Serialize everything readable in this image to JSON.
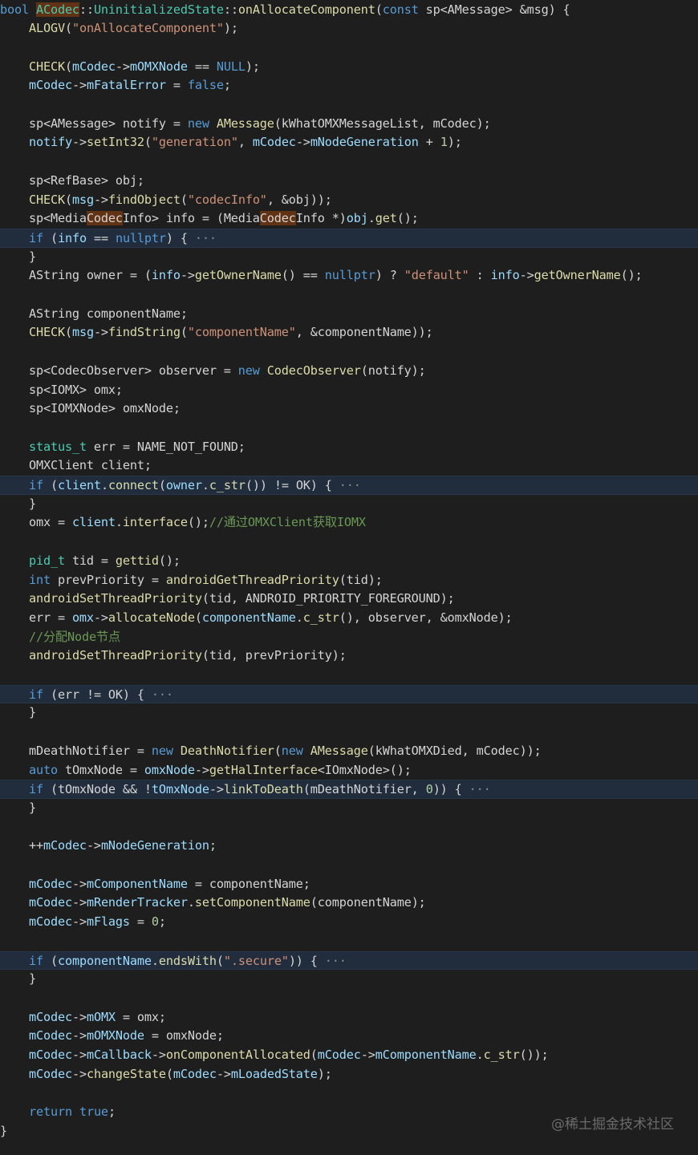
{
  "watermark": "@稀土掘金技术社区",
  "colors": {
    "background": "#1e1e1e",
    "fold_line_background": "#212c3c",
    "match_highlight": "#613214"
  },
  "code_lines": [
    [
      [
        "kw",
        "bool "
      ],
      [
        "hl",
        "ACodec"
      ],
      [
        "text",
        "::"
      ],
      [
        "type",
        "UninitializedState"
      ],
      [
        "text",
        "::"
      ],
      [
        "fn",
        "onAllocateComponent"
      ],
      [
        "text",
        "("
      ],
      [
        "kw",
        "const"
      ],
      [
        "text",
        " sp<AMessage> &msg) {"
      ]
    ],
    [
      [
        "text",
        "    "
      ],
      [
        "fn",
        "ALOGV"
      ],
      [
        "text",
        "("
      ],
      [
        "str",
        "\"onAllocateComponent\""
      ],
      [
        "text",
        ");"
      ]
    ],
    [],
    [
      [
        "text",
        "    "
      ],
      [
        "fn",
        "CHECK"
      ],
      [
        "text",
        "("
      ],
      [
        "var",
        "mCodec"
      ],
      [
        "text",
        "->"
      ],
      [
        "var",
        "mOMXNode"
      ],
      [
        "text",
        " == "
      ],
      [
        "kw",
        "NULL"
      ],
      [
        "text",
        ");"
      ]
    ],
    [
      [
        "text",
        "    "
      ],
      [
        "var",
        "mCodec"
      ],
      [
        "text",
        "->"
      ],
      [
        "var",
        "mFatalError"
      ],
      [
        "text",
        " = "
      ],
      [
        "kw",
        "false"
      ],
      [
        "text",
        ";"
      ]
    ],
    [],
    [
      [
        "text",
        "    sp<AMessage> notify = "
      ],
      [
        "kw",
        "new"
      ],
      [
        "text",
        " "
      ],
      [
        "fn",
        "AMessage"
      ],
      [
        "text",
        "(kWhatOMXMessageList, mCodec);"
      ]
    ],
    [
      [
        "text",
        "    "
      ],
      [
        "var",
        "notify"
      ],
      [
        "text",
        "->"
      ],
      [
        "fn",
        "setInt32"
      ],
      [
        "text",
        "("
      ],
      [
        "str",
        "\"generation\""
      ],
      [
        "text",
        ", "
      ],
      [
        "var",
        "mCodec"
      ],
      [
        "text",
        "->"
      ],
      [
        "var",
        "mNodeGeneration"
      ],
      [
        "text",
        " + "
      ],
      [
        "num",
        "1"
      ],
      [
        "text",
        ");"
      ]
    ],
    [],
    [
      [
        "text",
        "    sp<RefBase> obj;"
      ]
    ],
    [
      [
        "text",
        "    "
      ],
      [
        "fn",
        "CHECK"
      ],
      [
        "text",
        "("
      ],
      [
        "var",
        "msg"
      ],
      [
        "text",
        "->"
      ],
      [
        "fn",
        "findObject"
      ],
      [
        "text",
        "("
      ],
      [
        "str",
        "\"codecInfo\""
      ],
      [
        "text",
        ", &obj));"
      ]
    ],
    [
      [
        "text",
        "    sp<Media"
      ],
      [
        "hlt",
        "Codec"
      ],
      [
        "text",
        "Info> info = (Media"
      ],
      [
        "hlt",
        "Codec"
      ],
      [
        "text",
        "Info *)"
      ],
      [
        "var",
        "obj"
      ],
      [
        "text",
        "."
      ],
      [
        "fn",
        "get"
      ],
      [
        "text",
        "();"
      ]
    ],
    [
      [
        "text",
        "    "
      ],
      [
        "kw",
        "if"
      ],
      [
        "text",
        " ("
      ],
      [
        "var",
        "info"
      ],
      [
        "text",
        " == "
      ],
      [
        "kw",
        "nullptr"
      ],
      [
        "text",
        ") {"
      ],
      [
        "dim",
        " ···"
      ]
    ],
    [
      [
        "text",
        "    }"
      ]
    ],
    [
      [
        "text",
        "    AString owner = ("
      ],
      [
        "var",
        "info"
      ],
      [
        "text",
        "->"
      ],
      [
        "fn",
        "getOwnerName"
      ],
      [
        "text",
        "() == "
      ],
      [
        "kw",
        "nullptr"
      ],
      [
        "text",
        ") ? "
      ],
      [
        "str",
        "\"default\""
      ],
      [
        "text",
        " : "
      ],
      [
        "var",
        "info"
      ],
      [
        "text",
        "->"
      ],
      [
        "fn",
        "getOwnerName"
      ],
      [
        "text",
        "();"
      ]
    ],
    [],
    [
      [
        "text",
        "    AString componentName;"
      ]
    ],
    [
      [
        "text",
        "    "
      ],
      [
        "fn",
        "CHECK"
      ],
      [
        "text",
        "("
      ],
      [
        "var",
        "msg"
      ],
      [
        "text",
        "->"
      ],
      [
        "fn",
        "findString"
      ],
      [
        "text",
        "("
      ],
      [
        "str",
        "\"componentName\""
      ],
      [
        "text",
        ", &componentName));"
      ]
    ],
    [],
    [
      [
        "text",
        "    sp<CodecObserver> observer = "
      ],
      [
        "kw",
        "new"
      ],
      [
        "text",
        " "
      ],
      [
        "fn",
        "CodecObserver"
      ],
      [
        "text",
        "(notify);"
      ]
    ],
    [
      [
        "text",
        "    sp<IOMX> omx;"
      ]
    ],
    [
      [
        "text",
        "    sp<IOMXNode> omxNode;"
      ]
    ],
    [],
    [
      [
        "text",
        "    "
      ],
      [
        "type",
        "status_t"
      ],
      [
        "text",
        " err = NAME_NOT_FOUND;"
      ]
    ],
    [
      [
        "text",
        "    OMXClient client;"
      ]
    ],
    [
      [
        "text",
        "    "
      ],
      [
        "kw",
        "if"
      ],
      [
        "text",
        " ("
      ],
      [
        "var",
        "client"
      ],
      [
        "text",
        "."
      ],
      [
        "fn",
        "connect"
      ],
      [
        "text",
        "("
      ],
      [
        "var",
        "owner"
      ],
      [
        "text",
        "."
      ],
      [
        "fn",
        "c_str"
      ],
      [
        "text",
        "()) != OK) {"
      ],
      [
        "dim",
        " ···"
      ]
    ],
    [
      [
        "text",
        "    }"
      ]
    ],
    [
      [
        "text",
        "    omx = "
      ],
      [
        "var",
        "client"
      ],
      [
        "text",
        "."
      ],
      [
        "fn",
        "interface"
      ],
      [
        "text",
        "();"
      ],
      [
        "cmt",
        "//通过OMXClient获取IOMX"
      ]
    ],
    [],
    [
      [
        "text",
        "    "
      ],
      [
        "type",
        "pid_t"
      ],
      [
        "text",
        " tid = "
      ],
      [
        "fn",
        "gettid"
      ],
      [
        "text",
        "();"
      ]
    ],
    [
      [
        "text",
        "    "
      ],
      [
        "kw",
        "int"
      ],
      [
        "text",
        " prevPriority = "
      ],
      [
        "fn",
        "androidGetThreadPriority"
      ],
      [
        "text",
        "(tid);"
      ]
    ],
    [
      [
        "text",
        "    "
      ],
      [
        "fn",
        "androidSetThreadPriority"
      ],
      [
        "text",
        "(tid, ANDROID_PRIORITY_FOREGROUND);"
      ]
    ],
    [
      [
        "text",
        "    err = "
      ],
      [
        "var",
        "omx"
      ],
      [
        "text",
        "->"
      ],
      [
        "fn",
        "allocateNode"
      ],
      [
        "text",
        "("
      ],
      [
        "var",
        "componentName"
      ],
      [
        "text",
        "."
      ],
      [
        "fn",
        "c_str"
      ],
      [
        "text",
        "(), observer, &omxNode);"
      ]
    ],
    [
      [
        "text",
        "    "
      ],
      [
        "cmt",
        "//分配Node节点"
      ]
    ],
    [
      [
        "text",
        "    "
      ],
      [
        "fn",
        "androidSetThreadPriority"
      ],
      [
        "text",
        "(tid, prevPriority);"
      ]
    ],
    [],
    [
      [
        "text",
        "    "
      ],
      [
        "kw",
        "if"
      ],
      [
        "text",
        " (err != OK) {"
      ],
      [
        "dim",
        " ···"
      ]
    ],
    [
      [
        "text",
        "    }"
      ]
    ],
    [],
    [
      [
        "text",
        "    mDeathNotifier = "
      ],
      [
        "kw",
        "new"
      ],
      [
        "text",
        " "
      ],
      [
        "fn",
        "DeathNotifier"
      ],
      [
        "text",
        "("
      ],
      [
        "kw",
        "new"
      ],
      [
        "text",
        " "
      ],
      [
        "fn",
        "AMessage"
      ],
      [
        "text",
        "(kWhatOMXDied, mCodec));"
      ]
    ],
    [
      [
        "text",
        "    "
      ],
      [
        "kw",
        "auto"
      ],
      [
        "text",
        " tOmxNode = "
      ],
      [
        "var",
        "omxNode"
      ],
      [
        "text",
        "->"
      ],
      [
        "fn",
        "getHalInterface"
      ],
      [
        "text",
        "<IOmxNode>();"
      ]
    ],
    [
      [
        "text",
        "    "
      ],
      [
        "kw",
        "if"
      ],
      [
        "text",
        " (tOmxNode && !"
      ],
      [
        "var",
        "tOmxNode"
      ],
      [
        "text",
        "->"
      ],
      [
        "fn",
        "linkToDeath"
      ],
      [
        "text",
        "(mDeathNotifier, "
      ],
      [
        "num",
        "0"
      ],
      [
        "text",
        ")) {"
      ],
      [
        "dim",
        " ···"
      ]
    ],
    [
      [
        "text",
        "    }"
      ]
    ],
    [],
    [
      [
        "text",
        "    ++"
      ],
      [
        "var",
        "mCodec"
      ],
      [
        "text",
        "->"
      ],
      [
        "var",
        "mNodeGeneration"
      ],
      [
        "text",
        ";"
      ]
    ],
    [],
    [
      [
        "text",
        "    "
      ],
      [
        "var",
        "mCodec"
      ],
      [
        "text",
        "->"
      ],
      [
        "var",
        "mComponentName"
      ],
      [
        "text",
        " = componentName;"
      ]
    ],
    [
      [
        "text",
        "    "
      ],
      [
        "var",
        "mCodec"
      ],
      [
        "text",
        "->"
      ],
      [
        "var",
        "mRenderTracker"
      ],
      [
        "text",
        "."
      ],
      [
        "fn",
        "setComponentName"
      ],
      [
        "text",
        "(componentName);"
      ]
    ],
    [
      [
        "text",
        "    "
      ],
      [
        "var",
        "mCodec"
      ],
      [
        "text",
        "->"
      ],
      [
        "var",
        "mFlags"
      ],
      [
        "text",
        " = "
      ],
      [
        "num",
        "0"
      ],
      [
        "text",
        ";"
      ]
    ],
    [],
    [
      [
        "text",
        "    "
      ],
      [
        "kw",
        "if"
      ],
      [
        "text",
        " ("
      ],
      [
        "var",
        "componentName"
      ],
      [
        "text",
        "."
      ],
      [
        "fn",
        "endsWith"
      ],
      [
        "text",
        "("
      ],
      [
        "str",
        "\".secure\""
      ],
      [
        "text",
        ")) {"
      ],
      [
        "dim",
        " ···"
      ]
    ],
    [
      [
        "text",
        "    }"
      ]
    ],
    [],
    [
      [
        "text",
        "    "
      ],
      [
        "var",
        "mCodec"
      ],
      [
        "text",
        "->"
      ],
      [
        "var",
        "mOMX"
      ],
      [
        "text",
        " = omx;"
      ]
    ],
    [
      [
        "text",
        "    "
      ],
      [
        "var",
        "mCodec"
      ],
      [
        "text",
        "->"
      ],
      [
        "var",
        "mOMXNode"
      ],
      [
        "text",
        " = omxNode;"
      ]
    ],
    [
      [
        "text",
        "    "
      ],
      [
        "var",
        "mCodec"
      ],
      [
        "text",
        "->"
      ],
      [
        "var",
        "mCallback"
      ],
      [
        "text",
        "->"
      ],
      [
        "fn",
        "onComponentAllocated"
      ],
      [
        "text",
        "("
      ],
      [
        "var",
        "mCodec"
      ],
      [
        "text",
        "->"
      ],
      [
        "var",
        "mComponentName"
      ],
      [
        "text",
        "."
      ],
      [
        "fn",
        "c_str"
      ],
      [
        "text",
        "());"
      ]
    ],
    [
      [
        "text",
        "    "
      ],
      [
        "var",
        "mCodec"
      ],
      [
        "text",
        "->"
      ],
      [
        "fn",
        "changeState"
      ],
      [
        "text",
        "("
      ],
      [
        "var",
        "mCodec"
      ],
      [
        "text",
        "->"
      ],
      [
        "var",
        "mLoadedState"
      ],
      [
        "text",
        ");"
      ]
    ],
    [],
    [
      [
        "text",
        "    "
      ],
      [
        "kw",
        "return"
      ],
      [
        "text",
        " "
      ],
      [
        "kw",
        "true"
      ],
      [
        "text",
        ";"
      ]
    ],
    [
      [
        "text",
        "}"
      ]
    ]
  ]
}
